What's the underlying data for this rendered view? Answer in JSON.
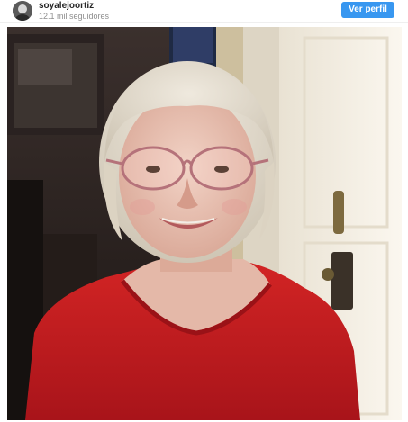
{
  "post": {
    "username": "soyalejoortiz",
    "followers": "12.1 mil seguidores",
    "view_profile_label": "Ver perfil",
    "avatar_icon": "profile-avatar",
    "photo_subject": "portrait photo"
  },
  "colors": {
    "button": "#3897f0",
    "sweater": "#c01d1d",
    "door": "#f2ece0"
  }
}
